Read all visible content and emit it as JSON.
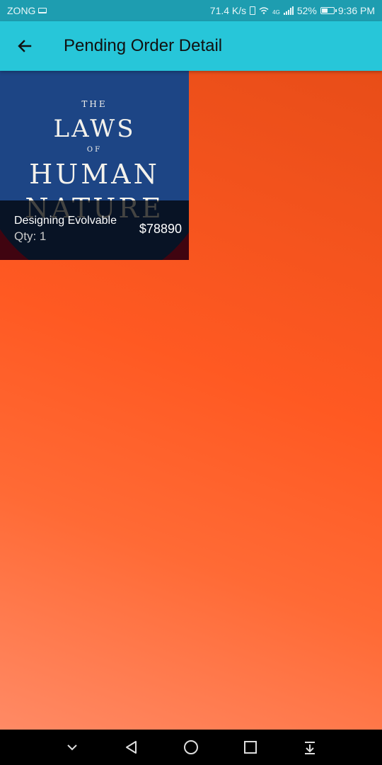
{
  "status_bar": {
    "carrier": "ZONG",
    "speed": "71.4 K/s",
    "network_type": "4G",
    "battery": "52%",
    "battery_level": 0.52,
    "time": "9:36 PM"
  },
  "app_bar": {
    "title": "Pending Order Detail",
    "back_icon": "arrow-left-icon"
  },
  "order_items": [
    {
      "name": "Designing Evolvable",
      "qty": "Qty: 1",
      "price": "$78890",
      "cover": {
        "line1": "THE",
        "line2": "LAWS",
        "line3": "OF",
        "line4": "HUMAN",
        "line5": "NATURE"
      }
    }
  ],
  "nav_bar": {
    "icons": [
      "chevron-down-icon",
      "back-triangle-icon",
      "home-circle-icon",
      "recents-square-icon",
      "notification-pull-icon"
    ]
  },
  "colors": {
    "status_bar": "#1e9db0",
    "app_bar": "#27c6d9",
    "background": "#ff5a24"
  }
}
